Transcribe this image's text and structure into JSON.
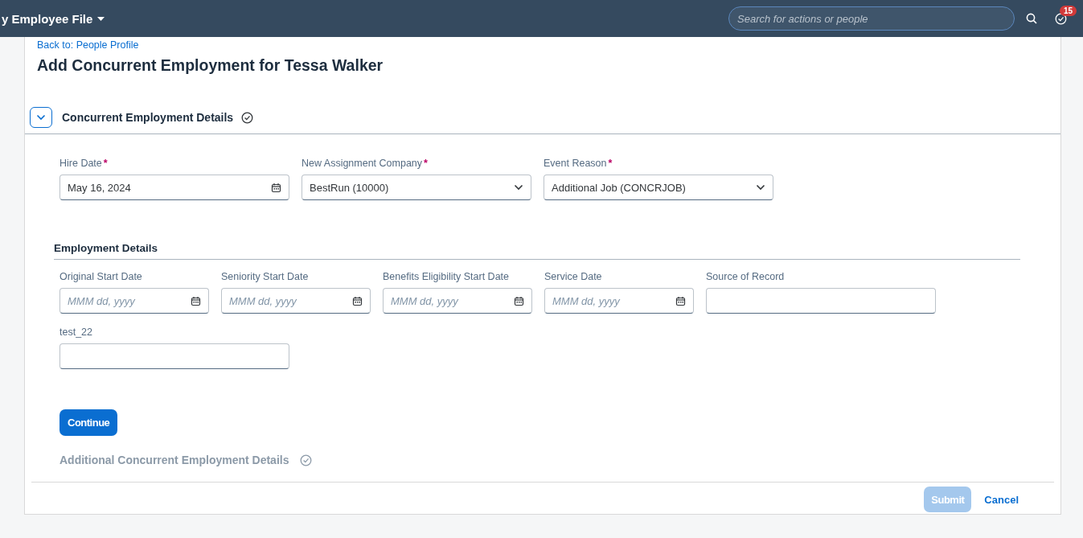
{
  "header": {
    "title": "y Employee File",
    "search": {
      "placeholder": "Search for actions or people"
    },
    "notifications": {
      "count": "15"
    }
  },
  "back_link": "Back to: People Profile",
  "page_title": "Add Concurrent Employment for Tessa Walker",
  "section": {
    "title": "Concurrent Employment Details",
    "expanded": true
  },
  "main_fields": [
    {
      "label": "Hire Date",
      "required_mark": "*",
      "kind": "date",
      "value": "May 16, 2024"
    },
    {
      "label": "New Assignment Company",
      "required_mark": "*",
      "kind": "select",
      "value": "BestRun (10000)"
    },
    {
      "label": "Event Reason",
      "required_mark": "*",
      "kind": "select",
      "value": "Additional Job (CONCRJOB)"
    }
  ],
  "employment_details": {
    "title": "Employment Details",
    "rows": [
      [
        {
          "label": "Original Start Date",
          "kind": "date",
          "placeholder": "MMM dd, yyyy"
        },
        {
          "label": "Seniority Start Date",
          "kind": "date",
          "placeholder": "MMM dd, yyyy"
        },
        {
          "label": "Benefits Eligibility Start Date",
          "kind": "date",
          "placeholder": "MMM dd, yyyy"
        },
        {
          "label": "Service Date",
          "kind": "date",
          "placeholder": "MMM dd, yyyy"
        },
        {
          "label": "Source of Record",
          "kind": "text"
        }
      ],
      [
        {
          "label": "test_22",
          "kind": "text"
        }
      ]
    ]
  },
  "continue_button": "Continue",
  "next_section": {
    "title": "Additional Concurrent Employment Details",
    "disabled": true
  },
  "footer": {
    "submit": {
      "label": "Submit",
      "disabled": true
    },
    "cancel": "Cancel"
  }
}
